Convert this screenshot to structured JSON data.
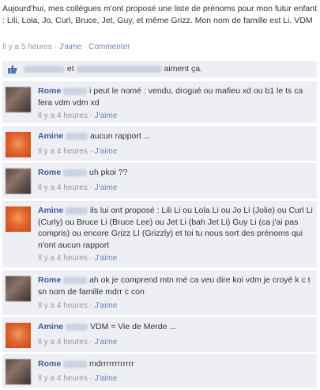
{
  "post": {
    "text": "Aujourd'hui, mes collègues m'ont proposé une liste de prénoms pour mon futur enfant : Lili, Lola, Jo, Curl, Bruce, Jet, Guy, et même Grizz. Mon nom de famille est Li. VDM",
    "time": "Il y a 5 heures",
    "sep": "·",
    "like_label": "J'aime",
    "comment_label": "Commenter"
  },
  "likes": {
    "connector": "et",
    "suffix": "aiment ça."
  },
  "comments": [
    {
      "author": "Rome",
      "text": "i peut le nomé : vendu, drogué ou mafieu xd ou b1 le ts ca fera vdm vdm xd",
      "time": "Il y a 4 heures",
      "like": "J'aime"
    },
    {
      "author": "Amine",
      "text": "aucun rapport ...",
      "time": "Il y a 4 heures",
      "like": "J'aime"
    },
    {
      "author": "Rome",
      "text": "uh pkoi ??",
      "time": "Il y a 4 heures",
      "like": "J'aime"
    },
    {
      "author": "Amine",
      "text": "ils lui ont proposé : Lili Li ou Lola Li ou Jo Li (Jolie) ou Curl Li (Curly) ou Bruce Li (Bruce Lee) ou Jet Li (bah Jet Li) Guy Li (ca j'ai pas compris) ou encore Grizz LI (Grizzly) et toi tu nous sort des prénoms qui n'ont aucun rapport",
      "time": "Il y a 4 heures",
      "like": "J'aime"
    },
    {
      "author": "Rome",
      "text": "ah ok je comprend mtn mé ca veu dire koi vdm je croyé k c t sn nom de famille mdrr c con",
      "time": "Il y a 4 heures",
      "like": "J'aime"
    },
    {
      "author": "Amine",
      "text": "VDM = Vie de Merde ...",
      "time": "Il y a 4 heures",
      "like": "J'aime"
    },
    {
      "author": "Rome",
      "text": "mdrrrrrrrrrrrr",
      "time": "Il y a 4 heures",
      "like": "J'aime"
    }
  ],
  "colors": {
    "link": "#3b5998",
    "meta_link": "#6d84b4",
    "comment_bg": "#edeff4"
  }
}
